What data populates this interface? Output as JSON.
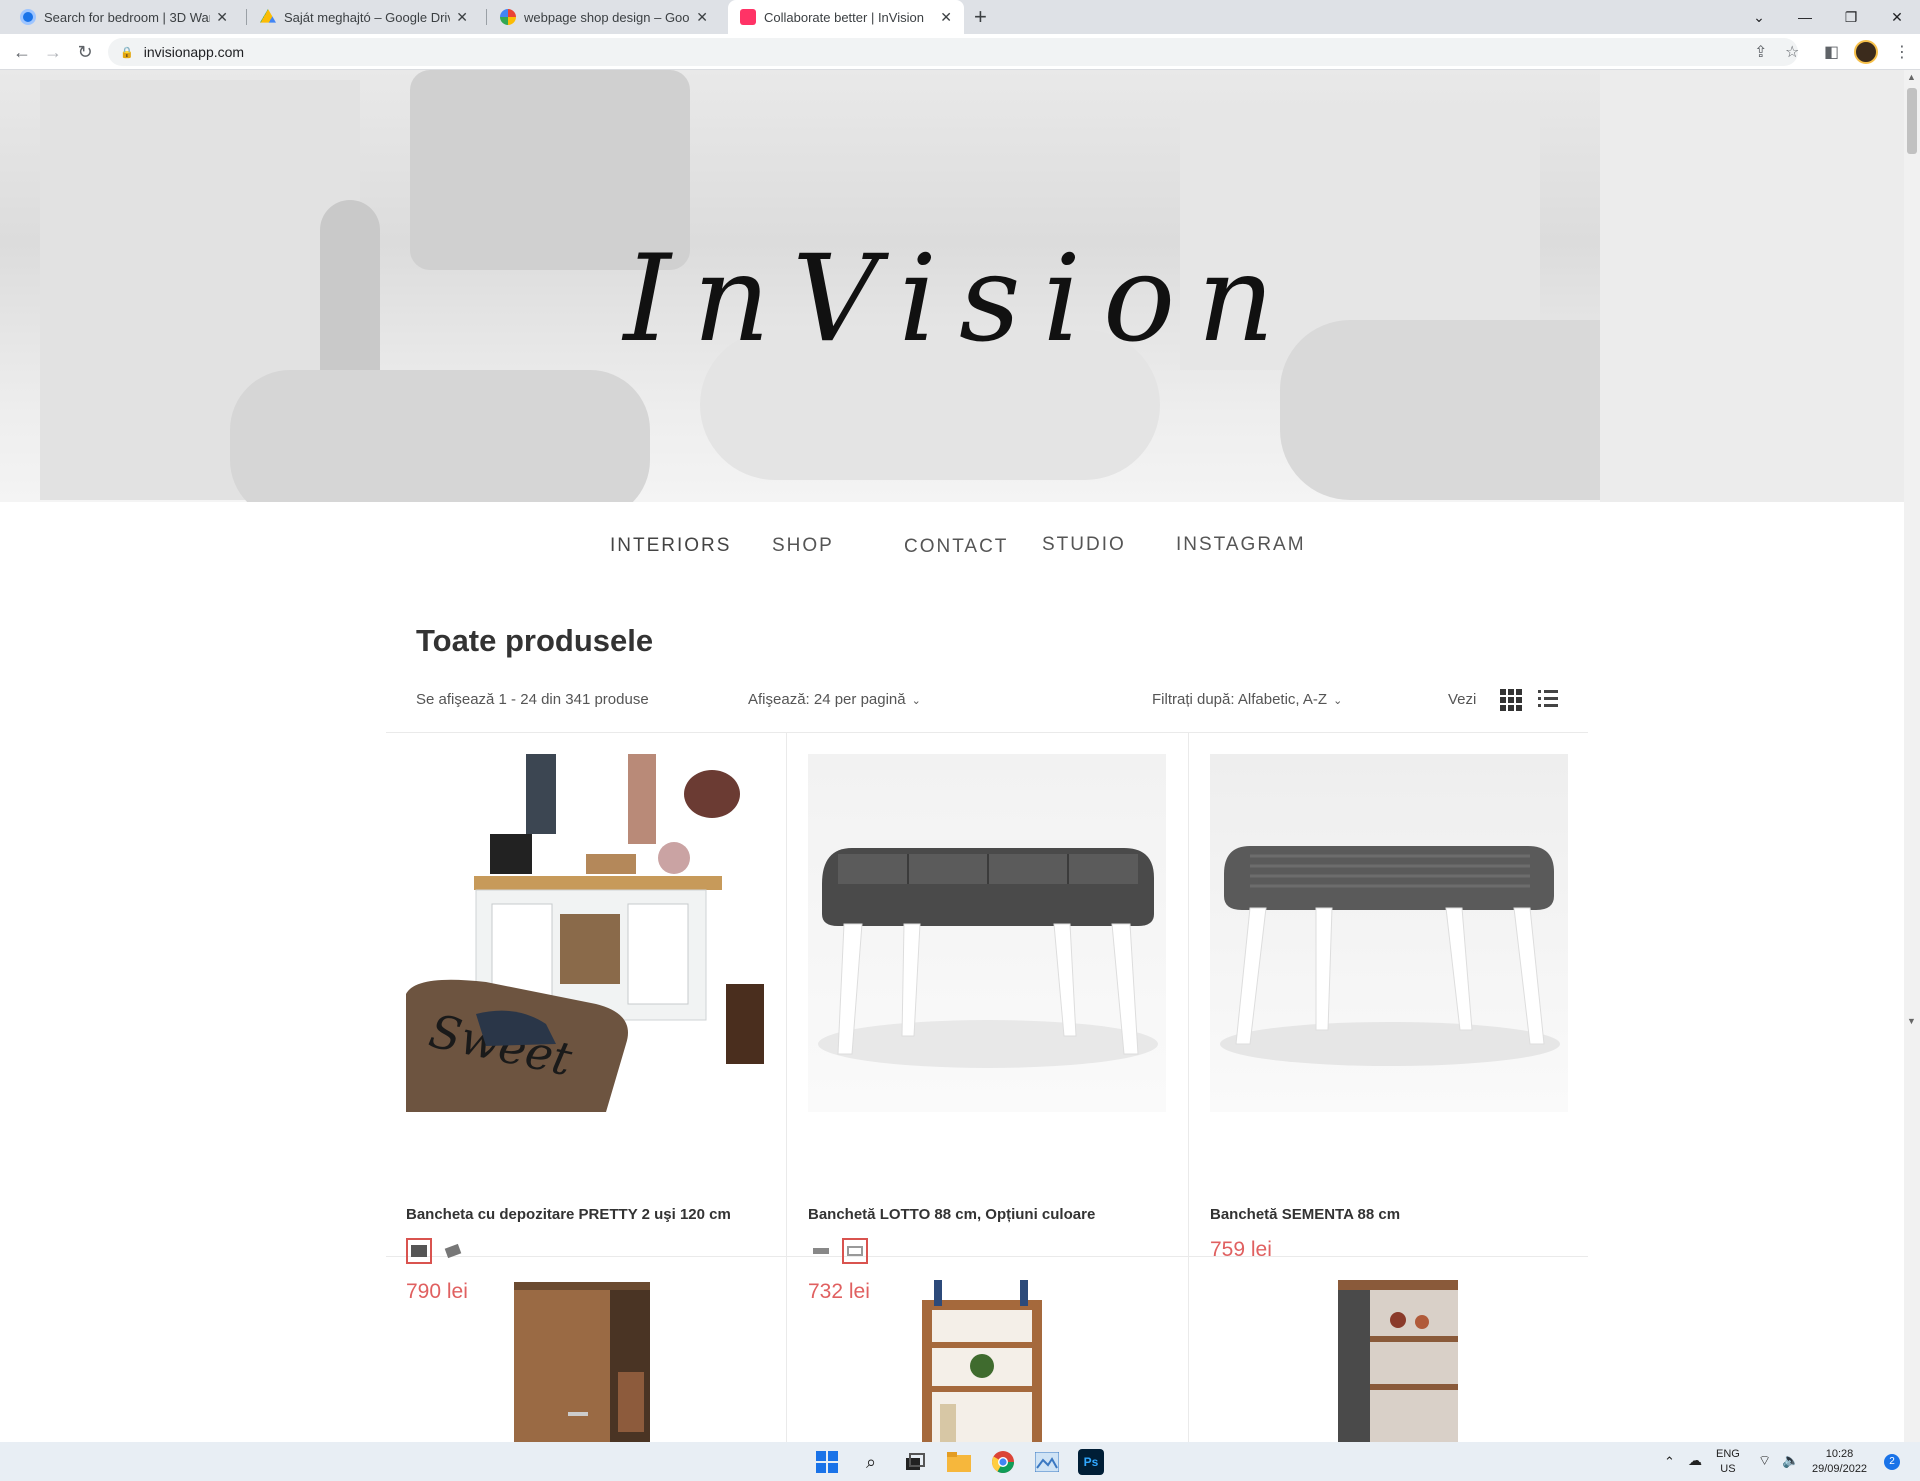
{
  "browser": {
    "tabs": [
      {
        "title": "Search for bedroom | 3D Wareho",
        "icon_color": "#1a73e8"
      },
      {
        "title": "Saját meghajtó – Google Drive",
        "icon_color": "#fbbc04"
      },
      {
        "title": "webpage shop design – Google I",
        "icon_color": "#4285f4"
      },
      {
        "title": "Collaborate better | InVision",
        "icon_color": "#ff3366"
      }
    ],
    "close_glyph": "✕",
    "new_tab_glyph": "+",
    "url": "invisionapp.com"
  },
  "site": {
    "logo": "InVision",
    "nav": [
      "INTERIORS",
      "SHOP",
      "CONTACT",
      "STUDIO",
      "INSTAGRAM"
    ]
  },
  "catalog": {
    "title": "Toate produsele",
    "results": "Se afişează 1 - 24 din 341 produse",
    "per_page": "Afişează: 24 per pagină",
    "sort": "Filtrați după: Alfabetic, A-Z",
    "view_label": "Vezi",
    "products": [
      {
        "name": "Bancheta cu depozitare PRETTY 2 uşi 120 cm",
        "price": "790 lei"
      },
      {
        "name": "Banchetă LOTTO 88 cm, Opțiuni culoare",
        "price": "732 lei"
      },
      {
        "name": "Banchetă SEMENTA 88 cm",
        "price": "759 lei"
      }
    ]
  },
  "taskbar": {
    "lang": "ENG",
    "region": "US",
    "time": "10:28",
    "date": "29/09/2022",
    "notifications": "2"
  },
  "colors": {
    "price": "#e06060",
    "selected_swatch": "#d9534f",
    "chrome_tabbar": "#dee1e6"
  }
}
